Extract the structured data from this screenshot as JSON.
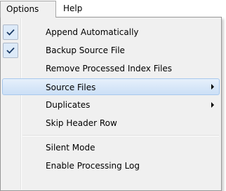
{
  "menubar": {
    "items": [
      {
        "label": "Options",
        "open": true
      },
      {
        "label": "Help"
      }
    ]
  },
  "menu": {
    "items": [
      {
        "label": "Append Automatically",
        "checked": true,
        "icon": "checkmark-icon"
      },
      {
        "label": "Backup Source File",
        "checked": true,
        "icon": "checkmark-icon"
      },
      {
        "label": "Remove Processed Index Files"
      },
      {
        "label": "Source Files",
        "submenu": true,
        "highlighted": true,
        "icon": "submenu-arrow-icon"
      },
      {
        "label": "Duplicates",
        "submenu": true,
        "icon": "submenu-arrow-icon"
      },
      {
        "label": "Skip Header Row"
      },
      {
        "label": "Silent Mode"
      },
      {
        "label": "Enable Processing Log"
      }
    ]
  },
  "colors": {
    "menu_background": "#f0f0f0",
    "highlight": "#cbdff6",
    "highlight_border": "#a8c8ed",
    "check_box": "#ddeaf8"
  }
}
